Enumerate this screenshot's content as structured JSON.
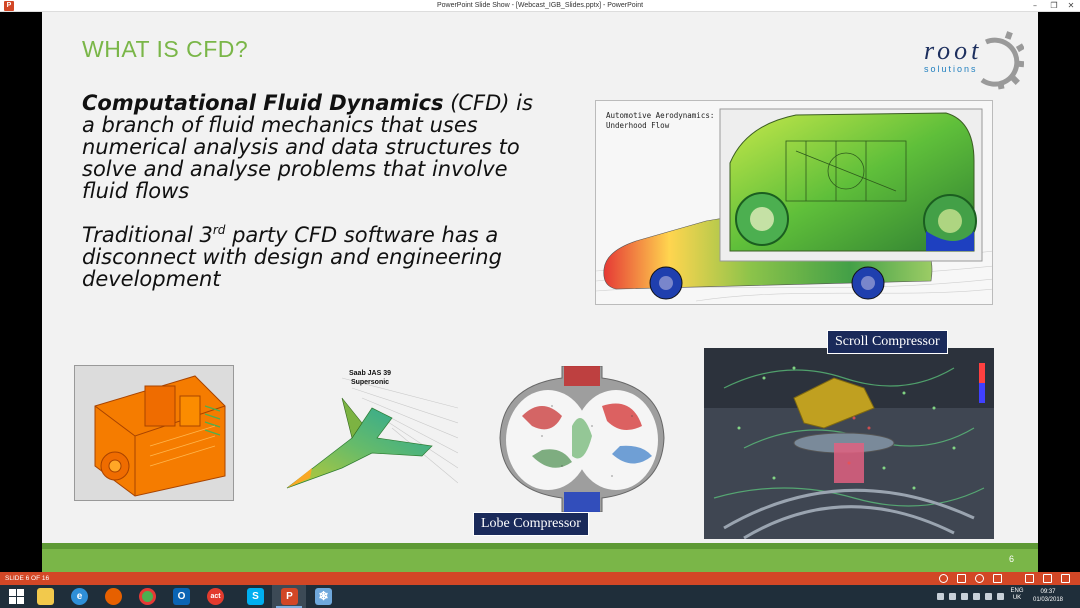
{
  "window": {
    "title": "PowerPoint Slide Show - [Webcast_IGB_Slides.pptx] - PowerPoint",
    "minimize": "–",
    "restore": "❐",
    "close": "✕"
  },
  "slide": {
    "title": "WHAT IS CFD?",
    "logo": {
      "word": "root",
      "sub": "solutions"
    },
    "paragraph1_bold": "Computational Fluid Dynamics",
    "paragraph1_rest": " (CFD) is a branch of fluid mechanics that uses numerical analysis and data structures to solve and analyse problems that involve fluid flows",
    "paragraph2_a": "Traditional 3",
    "paragraph2_sup": "rd",
    "paragraph2_b": " party CFD software has a disconnect with design and engineering development",
    "auto_caption_line1": "Automotive Aerodynamics:",
    "auto_caption_line2": "Underhood Flow",
    "jet_caption_line1": "Saab JAS 39",
    "jet_caption_line2": "Supersonic",
    "lobe_label": "Lobe Compressor",
    "scroll_label": "Scroll Compressor",
    "slide_number": "6"
  },
  "statusbar": {
    "slide_info": "SLIDE 6 OF 16"
  },
  "taskbar": {
    "apps": [
      {
        "name": "windows-start",
        "color": "#ffffff"
      },
      {
        "name": "file-explorer",
        "color": "#f2c94c"
      },
      {
        "name": "internet-explorer",
        "color": "#2f8fd8"
      },
      {
        "name": "firefox",
        "color": "#e66000"
      },
      {
        "name": "chrome",
        "color": "#4caf50"
      },
      {
        "name": "outlook",
        "color": "#0a64b4"
      },
      {
        "name": "act",
        "color": "#e23b2e"
      },
      {
        "name": "skype",
        "color": "#00aff0"
      },
      {
        "name": "powerpoint",
        "color": "#d24726"
      },
      {
        "name": "app-snowflake",
        "color": "#6fa8dc"
      }
    ],
    "lang_line1": "ENG",
    "lang_line2": "UK",
    "time": "09:37",
    "date": "01/03/2018"
  }
}
